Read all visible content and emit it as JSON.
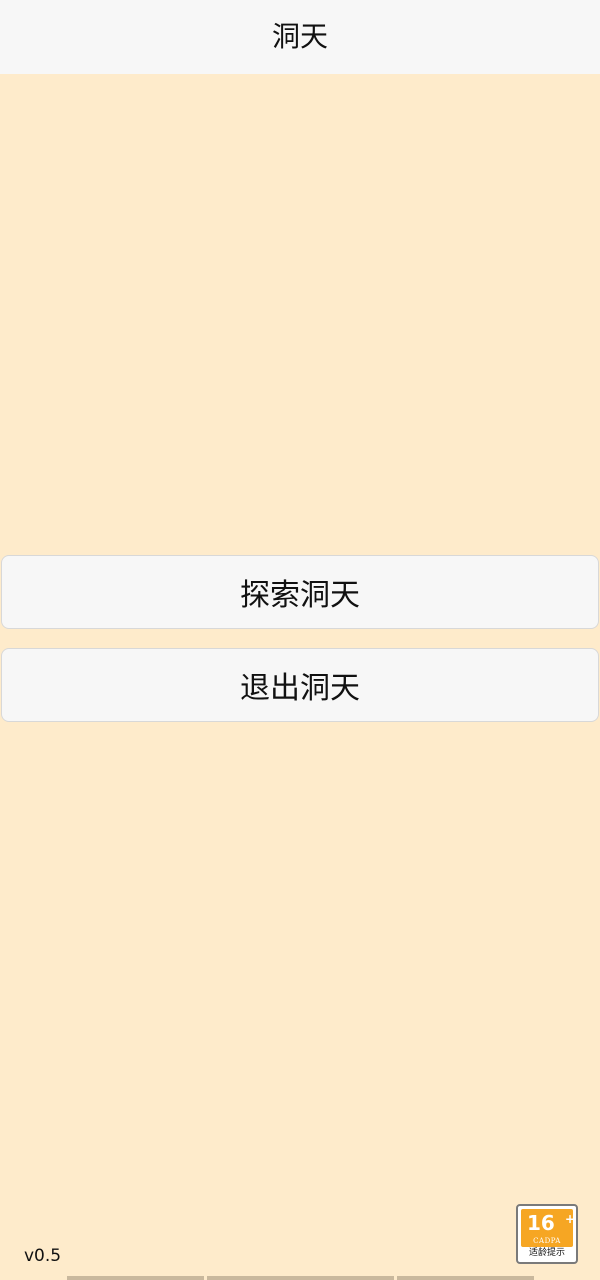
{
  "header": {
    "title": "洞天"
  },
  "actions": {
    "explore_label": "探索洞天",
    "exit_label": "退出洞天"
  },
  "footer": {
    "version": "v0.5"
  },
  "age_rating": {
    "age": "16",
    "plus": "+",
    "org": "CADPA",
    "text": "适龄提示"
  },
  "colors": {
    "background": "#FEEBCB",
    "header_bg": "#F7F7F7",
    "button_bg": "#F7F7F7",
    "badge_orange": "#F6A623"
  }
}
